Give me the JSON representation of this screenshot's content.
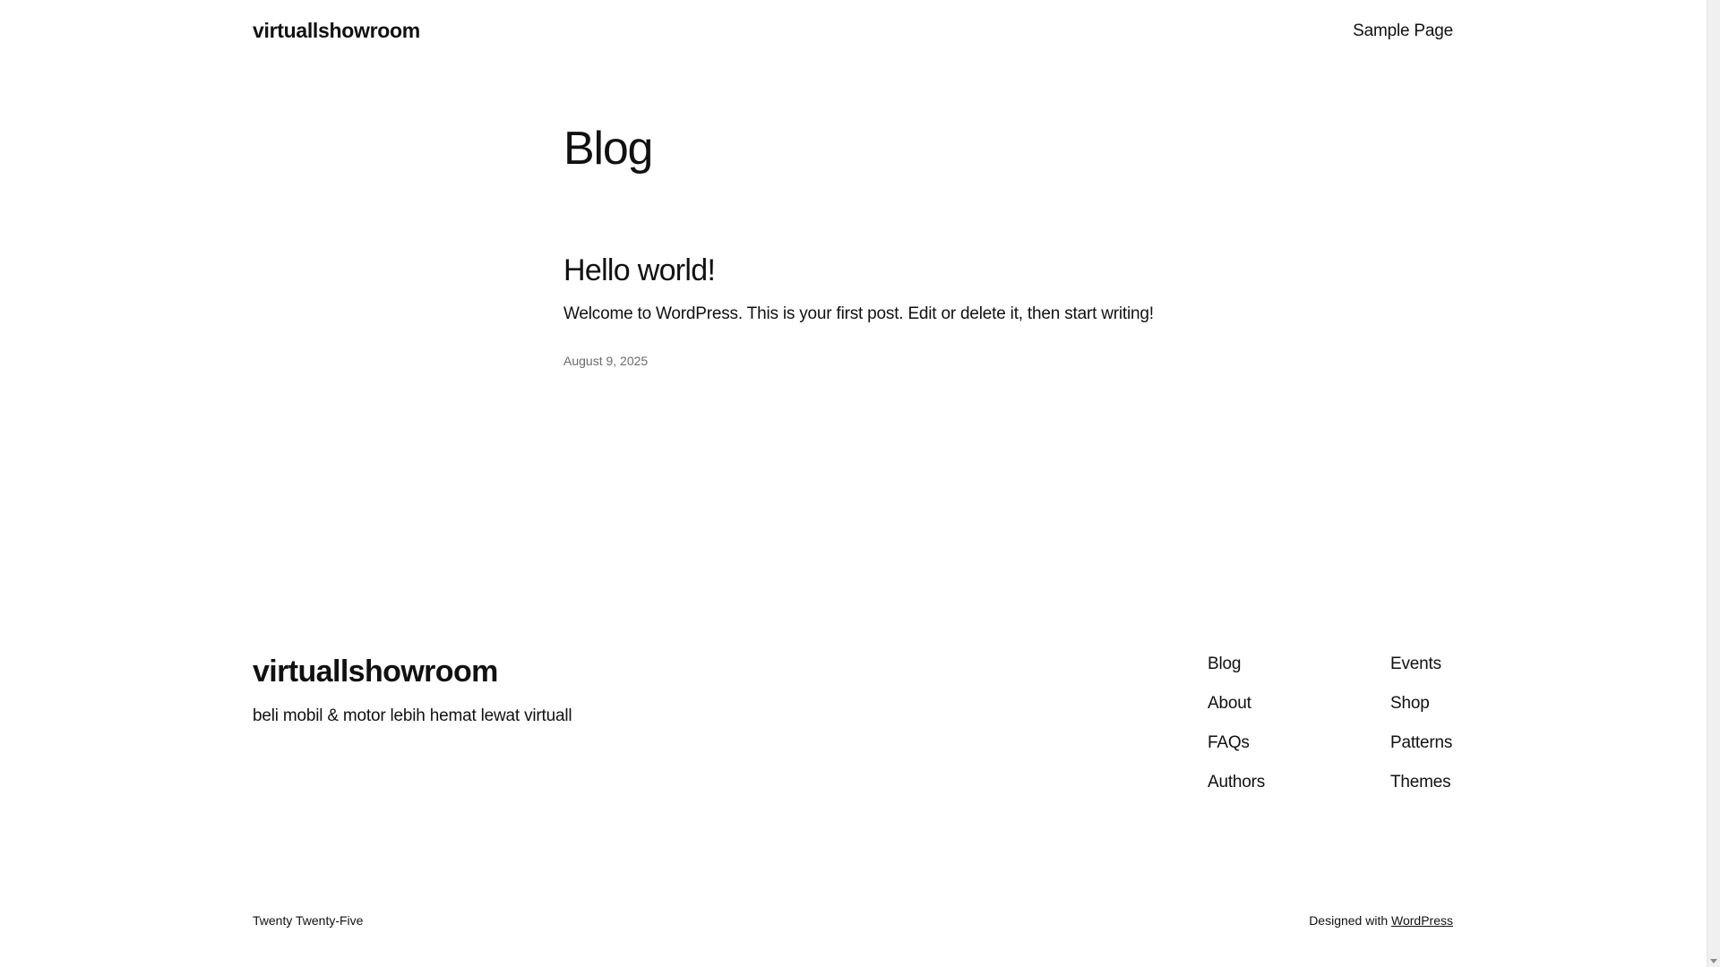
{
  "header": {
    "site_title": "virtuallshowroom",
    "nav": {
      "sample_page": "Sample Page"
    }
  },
  "main": {
    "page_title": "Blog",
    "posts": [
      {
        "title": "Hello world!",
        "excerpt": "Welcome to WordPress. This is your first post. Edit or delete it, then start writing!",
        "date": "August 9, 2025"
      }
    ]
  },
  "footer": {
    "site_title": "virtuallshowroom",
    "tagline": "beli mobil & motor lebih hemat lewat virtuall",
    "nav_col1": [
      "Blog",
      "About",
      "FAQs",
      "Authors"
    ],
    "nav_col2": [
      "Events",
      "Shop",
      "Patterns",
      "Themes"
    ],
    "theme_credit": "Twenty Twenty-Five",
    "designed_with": "Designed with",
    "wordpress_link": "WordPress"
  },
  "colors": {
    "background": "#ffffff",
    "text": "#111111",
    "muted": "#6b6b6b"
  }
}
